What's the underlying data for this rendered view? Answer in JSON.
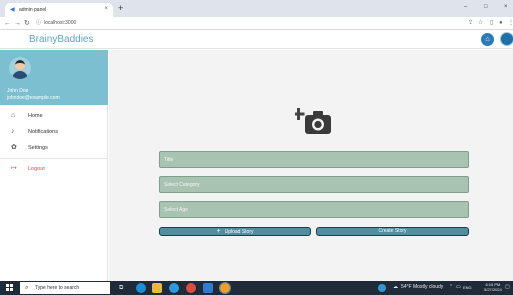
{
  "browser": {
    "tab_title": "admin panel",
    "tab_close": "×",
    "new_tab": "+",
    "url": "localhost:3000",
    "win_minimize": "–",
    "win_maximize": "□",
    "win_close": "×"
  },
  "app": {
    "brand": "BrainyBaddies"
  },
  "sidebar": {
    "user_name": "John Doe",
    "user_email": "johndoe@example.com",
    "items": [
      {
        "label": "Home",
        "icon": "home-icon",
        "glyph": "⌂"
      },
      {
        "label": "Notifications",
        "icon": "bell-icon",
        "glyph": "♪"
      },
      {
        "label": "Settings",
        "icon": "gear-icon",
        "glyph": "✿"
      }
    ],
    "logout": {
      "label": "Logout",
      "icon": "logout-icon",
      "glyph": "↦"
    }
  },
  "form": {
    "title_placeholder": "Title",
    "category_placeholder": "Select Category",
    "age_placeholder": "Select Age",
    "upload_label": "Upload Story",
    "upload_plus": "+",
    "create_label": "Create Story"
  },
  "taskbar": {
    "search_placeholder": "Type here to search",
    "weather": "54°F Mostly cloudy",
    "lang": "ENG",
    "time": "6:15 PM",
    "date": "5/27/2024"
  },
  "colors": {
    "brand": "#5aa6c2",
    "profile_bg": "#7cbfd0",
    "field_bg": "#a9c3b3",
    "button_bg": "#4e8fa0",
    "logout": "#e24b4b"
  }
}
